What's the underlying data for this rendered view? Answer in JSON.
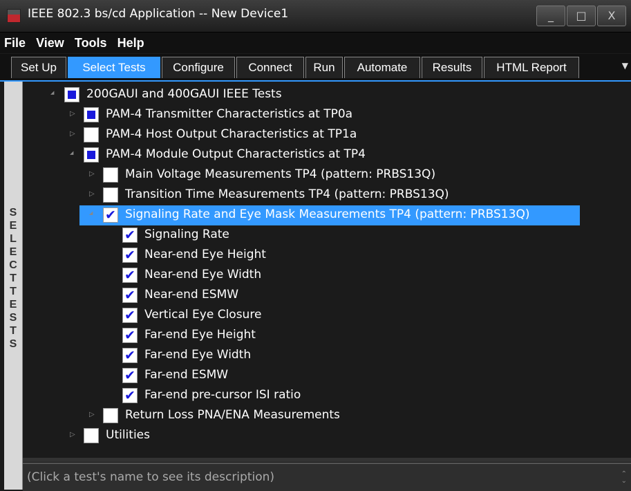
{
  "window": {
    "title": "IEEE 802.3 bs/cd Application -- New Device1",
    "buttons": [
      "_",
      "□",
      "X"
    ]
  },
  "menu": [
    "File",
    "View",
    "Tools",
    "Help"
  ],
  "tabs": [
    {
      "label": "Set Up",
      "active": false
    },
    {
      "label": "Select Tests",
      "active": true
    },
    {
      "label": "Configure",
      "active": false
    },
    {
      "label": "Connect",
      "active": false
    },
    {
      "label": "Run",
      "active": false
    },
    {
      "label": "Automate",
      "active": false
    },
    {
      "label": "Results",
      "active": false
    },
    {
      "label": "HTML Report",
      "active": false
    }
  ],
  "sidebar_label": "SELECT TESTS",
  "tree": [
    {
      "label": "200GAUI and 400GAUI IEEE Tests",
      "level": 0,
      "state": "partial",
      "expanded": true
    },
    {
      "label": "PAM-4 Transmitter Characteristics at TP0a",
      "level": 1,
      "state": "partial",
      "expanded": false
    },
    {
      "label": "PAM-4 Host Output Characteristics at TP1a",
      "level": 1,
      "state": "unchecked",
      "expanded": false
    },
    {
      "label": "PAM-4 Module Output Characteristics at TP4",
      "level": 1,
      "state": "partial",
      "expanded": true
    },
    {
      "label": "Main Voltage Measurements TP4 (pattern: PRBS13Q)",
      "level": 2,
      "state": "unchecked",
      "expanded": false
    },
    {
      "label": "Transition Time Measurements TP4 (pattern: PRBS13Q)",
      "level": 2,
      "state": "unchecked",
      "expanded": false
    },
    {
      "label": "Signaling Rate and Eye Mask Measurements TP4 (pattern: PRBS13Q)",
      "level": 2,
      "state": "checked",
      "expanded": true,
      "selected": true
    },
    {
      "label": "Signaling Rate",
      "level": 3,
      "state": "checked"
    },
    {
      "label": "Near-end Eye Height",
      "level": 3,
      "state": "checked"
    },
    {
      "label": "Near-end Eye Width",
      "level": 3,
      "state": "checked"
    },
    {
      "label": "Near-end ESMW",
      "level": 3,
      "state": "checked"
    },
    {
      "label": "Vertical Eye Closure",
      "level": 3,
      "state": "checked"
    },
    {
      "label": "Far-end Eye Height",
      "level": 3,
      "state": "checked"
    },
    {
      "label": "Far-end Eye Width",
      "level": 3,
      "state": "checked"
    },
    {
      "label": "Far-end ESMW",
      "level": 3,
      "state": "checked"
    },
    {
      "label": "Far-end pre-cursor ISI ratio",
      "level": 3,
      "state": "checked"
    },
    {
      "label": "Return Loss PNA/ENA Measurements",
      "level": 2,
      "state": "unchecked",
      "expanded": false
    },
    {
      "label": "Utilities",
      "level": 1,
      "state": "unchecked",
      "expanded": false
    }
  ],
  "status": "(Click a test's name to see its description)",
  "colors": {
    "accent": "#3399ff",
    "check": "#1a1adc",
    "background": "#1b1b1b"
  }
}
